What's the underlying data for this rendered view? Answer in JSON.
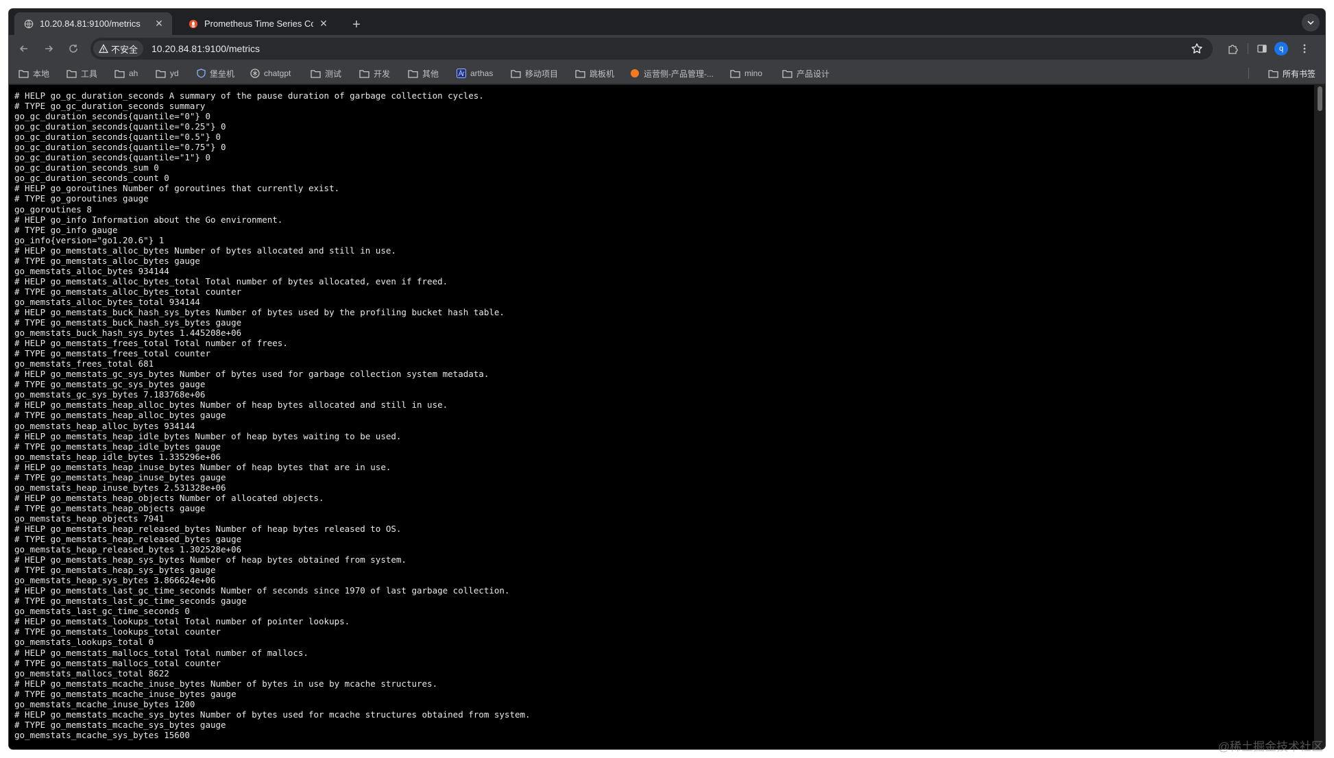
{
  "tabs": [
    {
      "title": "10.20.84.81:9100/metrics",
      "active": true,
      "favicon": "globe-icon"
    },
    {
      "title": "Prometheus Time Series Coll",
      "active": false,
      "favicon": "prometheus-icon"
    }
  ],
  "tab_close_glyph": "✕",
  "new_tab_glyph": "+",
  "address": {
    "security_label": "不安全",
    "url": "10.20.84.81:9100/metrics"
  },
  "profile_initial": "q",
  "bookmarks": [
    {
      "label": "本地",
      "icon": "folder-icon"
    },
    {
      "label": "工具",
      "icon": "folder-icon"
    },
    {
      "label": "ah",
      "icon": "folder-icon"
    },
    {
      "label": "yd",
      "icon": "folder-icon"
    },
    {
      "label": "堡垒机",
      "icon": "shield-icon"
    },
    {
      "label": "chatgpt",
      "icon": "openai-icon"
    },
    {
      "label": "测试",
      "icon": "folder-icon"
    },
    {
      "label": "开发",
      "icon": "folder-icon"
    },
    {
      "label": "其他",
      "icon": "folder-icon"
    },
    {
      "label": "arthas",
      "icon": "arthas-icon"
    },
    {
      "label": "移动项目",
      "icon": "folder-icon"
    },
    {
      "label": "跳板机",
      "icon": "folder-icon"
    },
    {
      "label": "运营侧-产品管理-...",
      "icon": "orange-circle-icon"
    },
    {
      "label": "mino",
      "icon": "folder-icon"
    },
    {
      "label": "产品设计",
      "icon": "folder-icon"
    }
  ],
  "all_bookmarks_label": "所有书签",
  "metrics_lines": [
    "# HELP go_gc_duration_seconds A summary of the pause duration of garbage collection cycles.",
    "# TYPE go_gc_duration_seconds summary",
    "go_gc_duration_seconds{quantile=\"0\"} 0",
    "go_gc_duration_seconds{quantile=\"0.25\"} 0",
    "go_gc_duration_seconds{quantile=\"0.5\"} 0",
    "go_gc_duration_seconds{quantile=\"0.75\"} 0",
    "go_gc_duration_seconds{quantile=\"1\"} 0",
    "go_gc_duration_seconds_sum 0",
    "go_gc_duration_seconds_count 0",
    "# HELP go_goroutines Number of goroutines that currently exist.",
    "# TYPE go_goroutines gauge",
    "go_goroutines 8",
    "# HELP go_info Information about the Go environment.",
    "# TYPE go_info gauge",
    "go_info{version=\"go1.20.6\"} 1",
    "# HELP go_memstats_alloc_bytes Number of bytes allocated and still in use.",
    "# TYPE go_memstats_alloc_bytes gauge",
    "go_memstats_alloc_bytes 934144",
    "# HELP go_memstats_alloc_bytes_total Total number of bytes allocated, even if freed.",
    "# TYPE go_memstats_alloc_bytes_total counter",
    "go_memstats_alloc_bytes_total 934144",
    "# HELP go_memstats_buck_hash_sys_bytes Number of bytes used by the profiling bucket hash table.",
    "# TYPE go_memstats_buck_hash_sys_bytes gauge",
    "go_memstats_buck_hash_sys_bytes 1.445208e+06",
    "# HELP go_memstats_frees_total Total number of frees.",
    "# TYPE go_memstats_frees_total counter",
    "go_memstats_frees_total 681",
    "# HELP go_memstats_gc_sys_bytes Number of bytes used for garbage collection system metadata.",
    "# TYPE go_memstats_gc_sys_bytes gauge",
    "go_memstats_gc_sys_bytes 7.183768e+06",
    "# HELP go_memstats_heap_alloc_bytes Number of heap bytes allocated and still in use.",
    "# TYPE go_memstats_heap_alloc_bytes gauge",
    "go_memstats_heap_alloc_bytes 934144",
    "# HELP go_memstats_heap_idle_bytes Number of heap bytes waiting to be used.",
    "# TYPE go_memstats_heap_idle_bytes gauge",
    "go_memstats_heap_idle_bytes 1.335296e+06",
    "# HELP go_memstats_heap_inuse_bytes Number of heap bytes that are in use.",
    "# TYPE go_memstats_heap_inuse_bytes gauge",
    "go_memstats_heap_inuse_bytes 2.531328e+06",
    "# HELP go_memstats_heap_objects Number of allocated objects.",
    "# TYPE go_memstats_heap_objects gauge",
    "go_memstats_heap_objects 7941",
    "# HELP go_memstats_heap_released_bytes Number of heap bytes released to OS.",
    "# TYPE go_memstats_heap_released_bytes gauge",
    "go_memstats_heap_released_bytes 1.302528e+06",
    "# HELP go_memstats_heap_sys_bytes Number of heap bytes obtained from system.",
    "# TYPE go_memstats_heap_sys_bytes gauge",
    "go_memstats_heap_sys_bytes 3.866624e+06",
    "# HELP go_memstats_last_gc_time_seconds Number of seconds since 1970 of last garbage collection.",
    "# TYPE go_memstats_last_gc_time_seconds gauge",
    "go_memstats_last_gc_time_seconds 0",
    "# HELP go_memstats_lookups_total Total number of pointer lookups.",
    "# TYPE go_memstats_lookups_total counter",
    "go_memstats_lookups_total 0",
    "# HELP go_memstats_mallocs_total Total number of mallocs.",
    "# TYPE go_memstats_mallocs_total counter",
    "go_memstats_mallocs_total 8622",
    "# HELP go_memstats_mcache_inuse_bytes Number of bytes in use by mcache structures.",
    "# TYPE go_memstats_mcache_inuse_bytes gauge",
    "go_memstats_mcache_inuse_bytes 1200",
    "# HELP go_memstats_mcache_sys_bytes Number of bytes used for mcache structures obtained from system.",
    "# TYPE go_memstats_mcache_sys_bytes gauge",
    "go_memstats_mcache_sys_bytes 15600"
  ],
  "watermark": "@稀土掘金技术社区"
}
